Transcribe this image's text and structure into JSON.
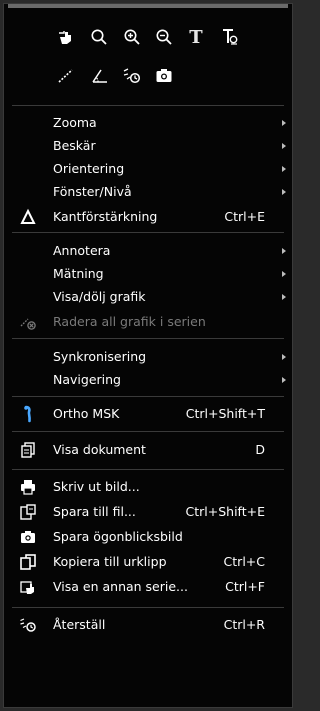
{
  "toolbar": {
    "row1": [
      {
        "name": "pan-hand-icon"
      },
      {
        "name": "magnifier-icon"
      },
      {
        "name": "zoom-in-icon"
      },
      {
        "name": "zoom-out-icon"
      },
      {
        "name": "text-tool-icon",
        "glyph": "T"
      },
      {
        "name": "text-annotation-icon",
        "glyph": "Tc"
      }
    ],
    "row2": [
      {
        "name": "line-measure-icon"
      },
      {
        "name": "angle-measure-icon"
      },
      {
        "name": "reset-tool-icon"
      },
      {
        "name": "camera-icon"
      }
    ]
  },
  "menu": {
    "items": [
      {
        "label": "Zooma",
        "submenu": true
      },
      {
        "label": "Beskär",
        "submenu": true
      },
      {
        "label": "Orientering",
        "submenu": true
      },
      {
        "label": "Fönster/Nivå",
        "submenu": true
      },
      {
        "label": "Kantförstärkning",
        "shortcut": "Ctrl+E",
        "icon": "delta-icon"
      },
      {
        "label": "Annotera",
        "submenu": true
      },
      {
        "label": "Mätning",
        "submenu": true
      },
      {
        "label": "Visa/dölj grafik",
        "submenu": true
      },
      {
        "label": "Radera all grafik i serien",
        "disabled": true,
        "icon": "erase-graphics-icon"
      },
      {
        "label": "Synkronisering",
        "submenu": true
      },
      {
        "label": "Navigering",
        "submenu": true
      },
      {
        "label": "Ortho MSK",
        "shortcut": "Ctrl+Shift+T",
        "icon": "ortho-msk-icon"
      },
      {
        "label": "Visa dokument",
        "shortcut": "D",
        "icon": "document-icon"
      },
      {
        "label": "Skriv ut bild...",
        "icon": "printer-icon"
      },
      {
        "label": "Spara till fil...",
        "shortcut": "Ctrl+Shift+E",
        "icon": "save-to-file-icon"
      },
      {
        "label": "Spara ögonblicksbild",
        "icon": "camera-icon"
      },
      {
        "label": "Kopiera till urklipp",
        "shortcut": "Ctrl+C",
        "icon": "copy-icon"
      },
      {
        "label": "Visa en annan serie...",
        "shortcut": "Ctrl+F",
        "icon": "show-series-icon"
      },
      {
        "label": "Återställ",
        "shortcut": "Ctrl+R",
        "icon": "reset-icon"
      }
    ]
  },
  "colors": {
    "background": "#050505",
    "text": "#ffffff",
    "disabled_text": "#7a7a7a",
    "separator": "#3a3a3a"
  }
}
